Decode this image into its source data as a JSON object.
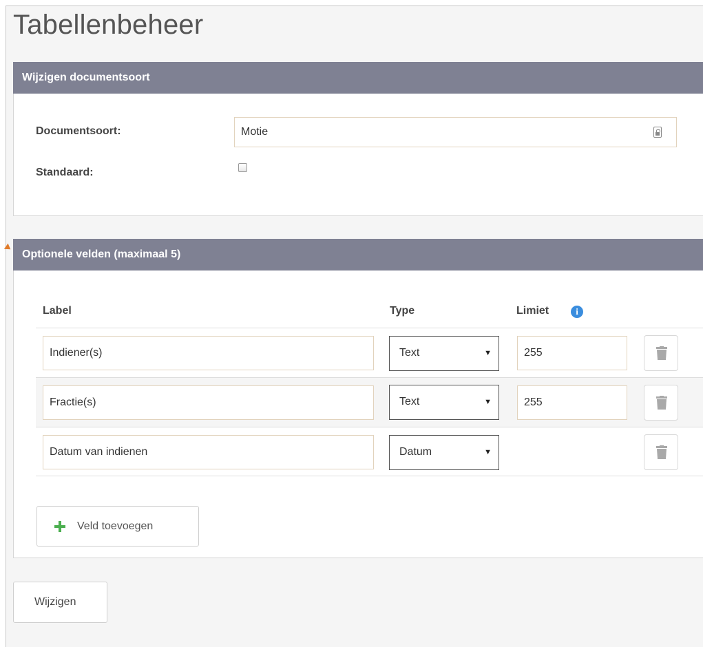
{
  "page": {
    "title": "Tabellenbeheer"
  },
  "edit_panel": {
    "header": "Wijzigen documentsoort",
    "documentsoort_label": "Documentsoort:",
    "documentsoort_value": "Motie",
    "standaard_label": "Standaard:",
    "standaard_checked": false
  },
  "optional_fields": {
    "header": "Optionele velden (maximaal 5)",
    "columns": {
      "label": "Label",
      "type": "Type",
      "limit": "Limiet"
    },
    "info_icon": "i",
    "rows": [
      {
        "label": "Indiener(s)",
        "type": "Text",
        "limit": "255"
      },
      {
        "label": "Fractie(s)",
        "type": "Text",
        "limit": "255"
      },
      {
        "label": "Datum van indienen",
        "type": "Datum",
        "limit": ""
      }
    ],
    "add_button_label": "Veld toevoegen"
  },
  "footer": {
    "submit_label": "Wijzigen"
  },
  "colors": {
    "panel_header": "#7f8193",
    "add_icon": "#4caf50",
    "info_icon": "#3a8dde",
    "marker": "#e07b2b"
  },
  "icons": [
    "address-book-icon",
    "info-icon",
    "trash-icon",
    "plus-icon",
    "chevron-down-icon"
  ]
}
